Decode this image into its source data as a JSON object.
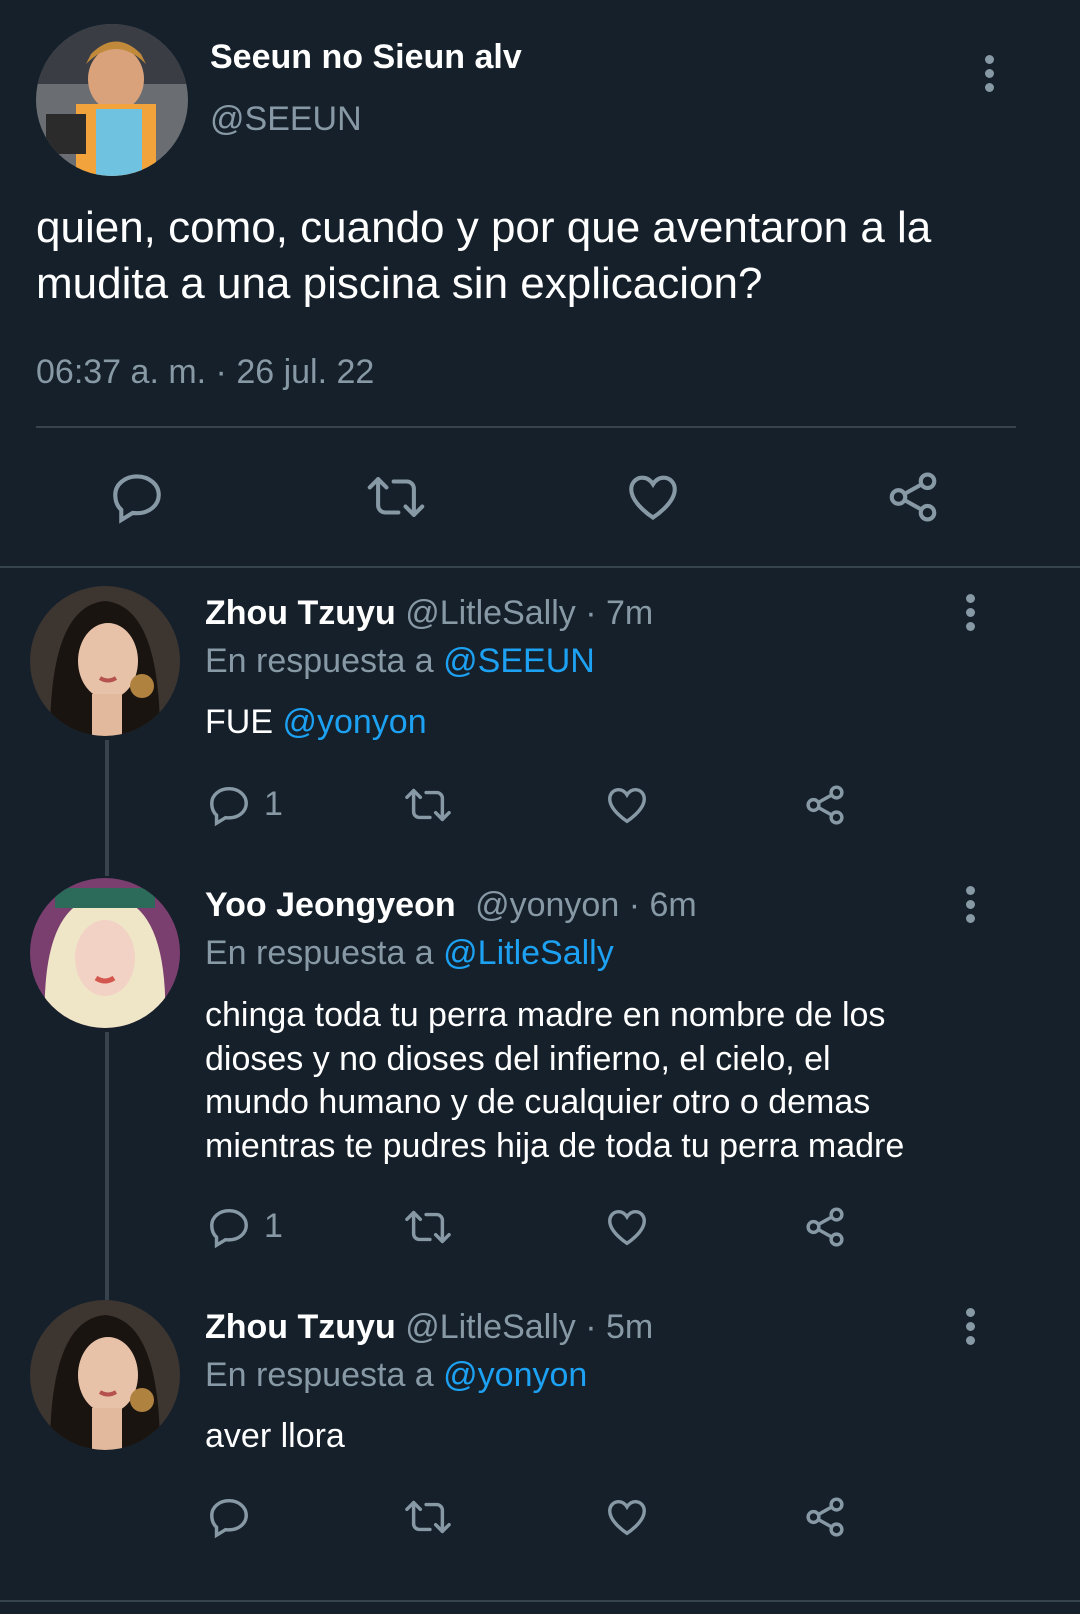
{
  "main_tweet": {
    "display_name": "Seeun no Sieun alv",
    "handle": "@SEEUN",
    "text_line1": "quien, como, cuando y por que aventaron a la",
    "text_line2": "mudita a una piscina sin explicacion?",
    "timestamp": "06:37 a. m. · 26 jul. 22",
    "actions": [
      "reply-icon",
      "retweet-icon",
      "like-icon",
      "share-icon"
    ]
  },
  "replies": [
    {
      "display_name": "Zhou Tzuyu",
      "handle": "@LitleSally",
      "time": "· 7m",
      "replying_prefix": "En respuesta a",
      "replying_to": "@SEEUN",
      "text_prefix": "FUE",
      "text_mention": "@yonyon",
      "reply_count": "1"
    },
    {
      "display_name": "Yoo Jeongyeon",
      "handle": "@yonyon",
      "time": "· 6m",
      "replying_prefix": "En respuesta a",
      "replying_to": "@LitleSally",
      "text_lines": [
        "chinga toda tu perra madre en nombre de los",
        "dioses y no dioses del infierno, el cielo, el",
        "mundo humano y de cualquier otro o demas",
        "mientras te pudres hija de toda tu perra madre"
      ],
      "reply_count": "1"
    },
    {
      "display_name": "Zhou Tzuyu",
      "handle": "@LitleSally",
      "time": "· 5m",
      "replying_prefix": "En respuesta a",
      "replying_to": "@yonyon",
      "text": "aver llora"
    }
  ],
  "colors": {
    "background": "#15202b",
    "link": "#1da1f2",
    "secondary_text": "#8899a6",
    "divider": "#38444d"
  }
}
